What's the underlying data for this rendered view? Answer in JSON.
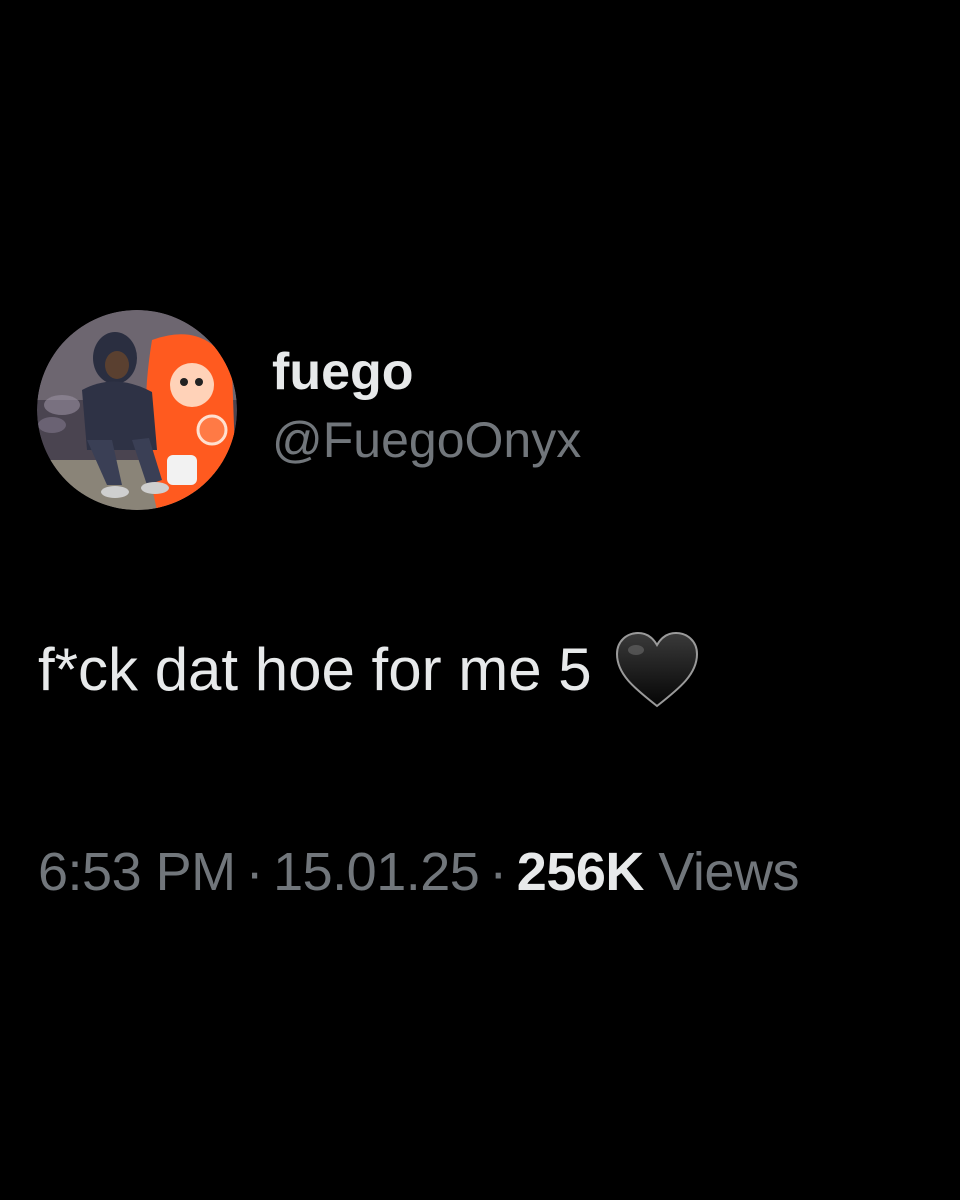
{
  "tweet": {
    "display_name": "fuego",
    "handle": "@FuegoOnyx",
    "text": "f*ck dat hoe for me 5",
    "emoji": "black-heart",
    "time": "6:53 PM",
    "date": "15.01.25",
    "separator": "·",
    "views_count": "256K",
    "views_label": "Views"
  },
  "colors": {
    "background": "#000000",
    "primary_text": "#e7e9ea",
    "secondary_text": "#71767b",
    "avatar_accent": "#ff5a1f"
  }
}
